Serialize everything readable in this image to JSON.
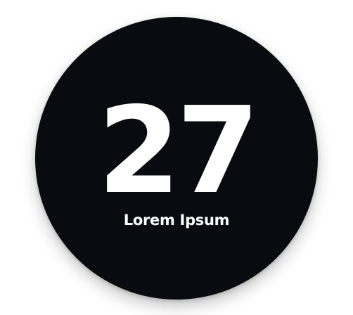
{
  "badge": {
    "number": "27",
    "caption": "Lorem Ipsum"
  },
  "colors": {
    "background": "#ffffff",
    "circle": "#0a0b10",
    "text": "#ffffff"
  }
}
